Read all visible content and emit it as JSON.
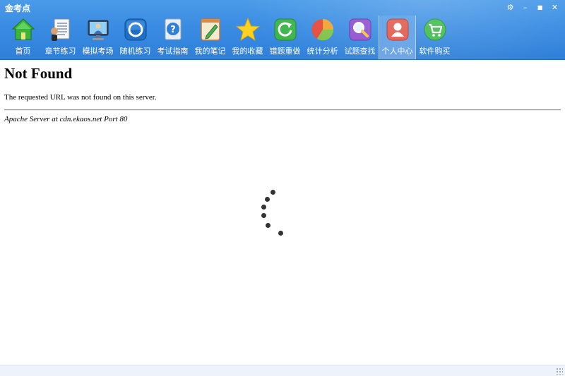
{
  "window": {
    "title": "金考点",
    "controls": [
      {
        "name": "settings-button",
        "icon": "gear-icon",
        "glyph": "⚙"
      },
      {
        "name": "minimize-button",
        "icon": "minimize-icon",
        "glyph": "–"
      },
      {
        "name": "maximize-button",
        "icon": "maximize-icon",
        "glyph": "■"
      },
      {
        "name": "close-button",
        "icon": "close-icon",
        "glyph": "✕"
      }
    ]
  },
  "toolbar": {
    "items": [
      {
        "label": "首页",
        "icon": "home-icon",
        "active": false
      },
      {
        "label": "章节练习",
        "icon": "document-pen-icon",
        "active": false
      },
      {
        "label": "模拟考场",
        "icon": "monitor-person-icon",
        "active": false
      },
      {
        "label": "随机练习",
        "icon": "random-cycle-icon",
        "active": false
      },
      {
        "label": "考试指南",
        "icon": "question-book-icon",
        "active": false
      },
      {
        "label": "我的笔记",
        "icon": "notebook-pencil-icon",
        "active": false
      },
      {
        "label": "我的收藏",
        "icon": "star-icon",
        "active": false
      },
      {
        "label": "错题重做",
        "icon": "refresh-icon",
        "active": false
      },
      {
        "label": "统计分析",
        "icon": "pie-chart-icon",
        "active": false
      },
      {
        "label": "试题查找",
        "icon": "magnifier-icon",
        "active": false
      },
      {
        "label": "个人中心",
        "icon": "user-icon",
        "active": true
      },
      {
        "label": "软件购买",
        "icon": "cart-icon",
        "active": false
      }
    ]
  },
  "page": {
    "heading": "Not Found",
    "message": "The requested URL was not found on this server.",
    "address": "Apache Server at cdn.ekaos.net Port 80"
  },
  "colors": {
    "toolbar_bg": "#3a8ce3",
    "toolbar_text": "#ffffff"
  }
}
